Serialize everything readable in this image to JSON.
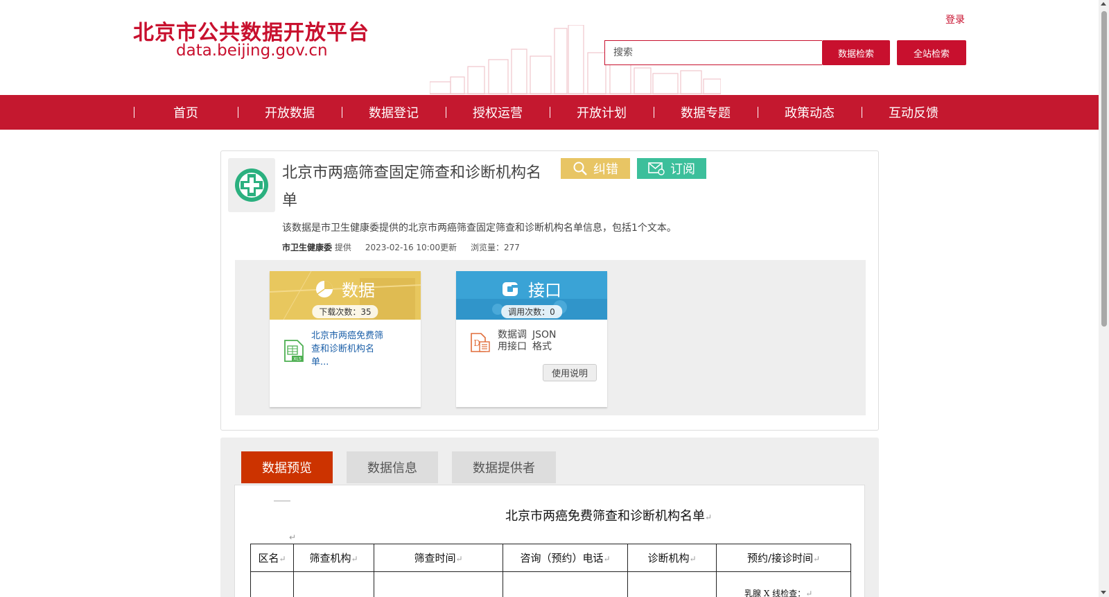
{
  "header": {
    "site_title": "北京市公共数据开放平台",
    "site_domain": "data.beijing.gov.cn",
    "login_label": "登录",
    "search_placeholder": "搜索",
    "data_search_label": "数据检索",
    "site_search_label": "全站检索"
  },
  "nav": {
    "items": [
      "首页",
      "开放数据",
      "数据登记",
      "授权运营",
      "开放计划",
      "数据专题",
      "政策动态",
      "互动反馈"
    ]
  },
  "dataset": {
    "title": "北京市两癌筛查固定筛查和诊断机构名单",
    "correct_label": "纠错",
    "subscribe_label": "订阅",
    "description": "该数据是市卫生健康委提供的北京市两癌筛查固定筛查和诊断机构名单信息，包括1个文本。",
    "provider": "市卫生健康委",
    "provider_suffix": "提供",
    "updated": "2023-02-16 10:00更新",
    "views": "浏览量：277"
  },
  "resources": {
    "data": {
      "label": "数据",
      "count": "下载次数：35",
      "file_name": "北京市两癌免费筛查和诊断机构名单...",
      "file_icon": "xls-file-icon"
    },
    "api": {
      "label": "接口",
      "count": "调用次数：0",
      "name": "数据调用接口",
      "format": "JSON格式",
      "usage_label": "使用说明"
    }
  },
  "tabs": [
    "数据预览",
    "数据信息",
    "数据提供者"
  ],
  "preview": {
    "doc_title": "北京市两癌免费筛查和诊断机构名单",
    "columns": [
      "区名",
      "筛查机构",
      "筛查时间",
      "咨询（预约）电话",
      "诊断机构",
      "预约/接诊时间"
    ],
    "partial_cell": "乳腺 X 线检查："
  },
  "colors": {
    "brand_red": "#c8102e",
    "nav_red": "#c4182f",
    "active_tab": "#cc3300",
    "correct_yellow": "#e8c564",
    "subscribe_green": "#3cbf9b"
  }
}
